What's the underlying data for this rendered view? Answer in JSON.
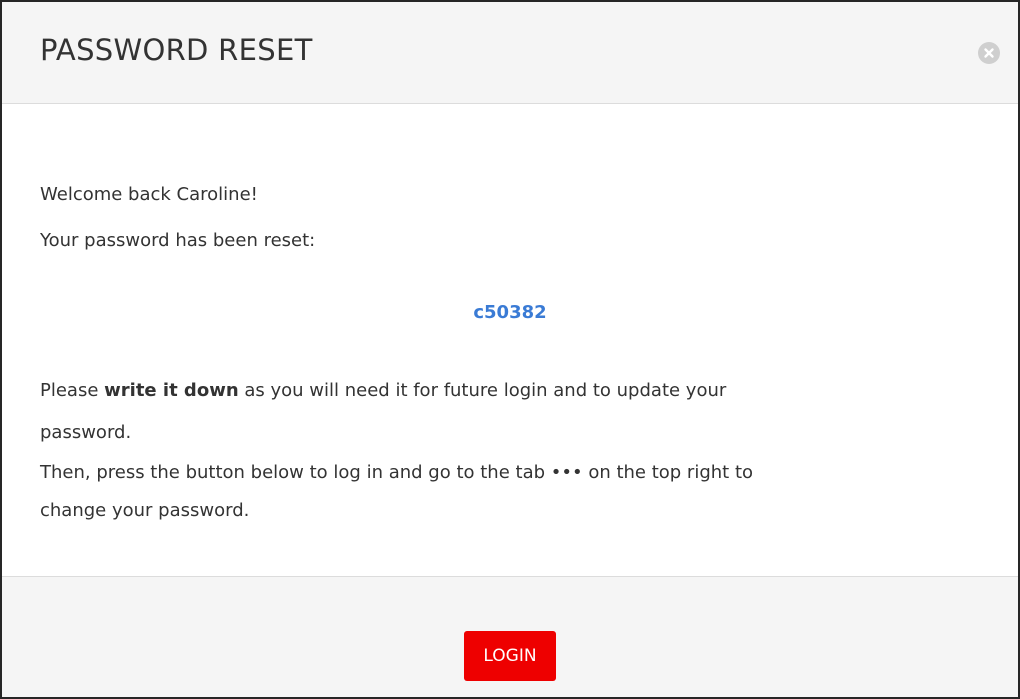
{
  "dialog": {
    "title": "PASSWORD RESET",
    "close_icon": "close-circle-icon"
  },
  "body": {
    "greeting": "Welcome back Caroline!",
    "reset_message": "Your password has been reset:",
    "new_password": "c50382",
    "instruction_prefix": "Please ",
    "instruction_bold": "write it down",
    "instruction_suffix": " as you will need it for future login and to update your",
    "instruction_line2": "password.",
    "then_line1": "Then, press the button below to log in and go to the tab ••• on the top right to",
    "then_line2": "change your password."
  },
  "footer": {
    "login_label": "LOGIN"
  },
  "colors": {
    "accent_link": "#3a7bd5",
    "login_button": "#ee0000",
    "header_bg": "#f5f5f5"
  }
}
